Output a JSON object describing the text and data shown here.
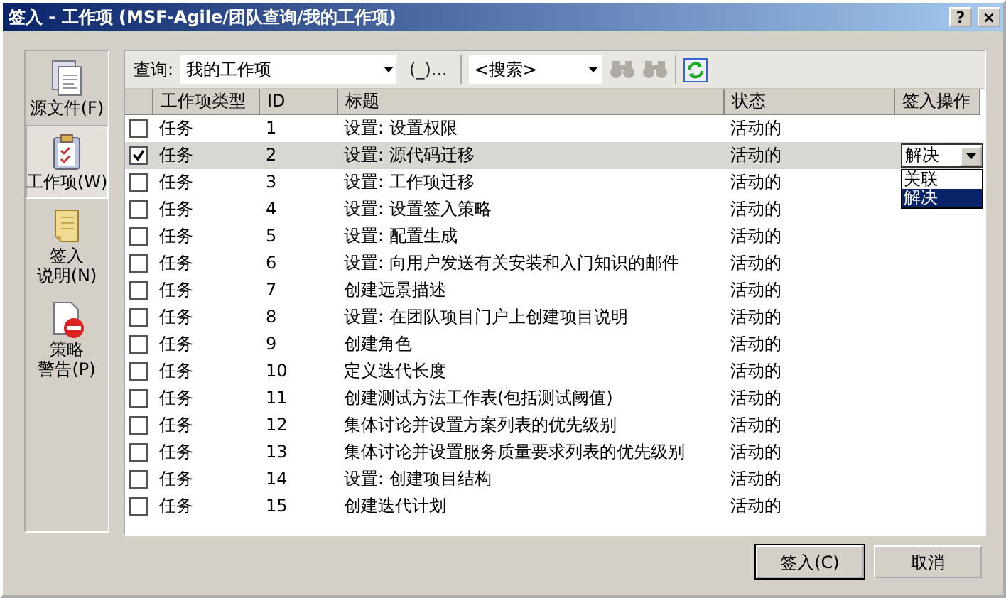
{
  "window": {
    "title": "签入 - 工作项 (MSF-Agile/团队查询/我的工作项)",
    "help_button": "?",
    "close_button": "×"
  },
  "sidebar": {
    "items": [
      {
        "label_lines": [
          "源文件(F)"
        ],
        "kind": "files",
        "selected": false
      },
      {
        "label_lines": [
          "工作项(W)"
        ],
        "kind": "clipboard",
        "selected": true
      },
      {
        "label_lines": [
          "签入",
          "说明(N)"
        ],
        "kind": "notes",
        "selected": false
      },
      {
        "label_lines": [
          "策略",
          "警告(P)"
        ],
        "kind": "policy",
        "selected": false
      }
    ]
  },
  "toolbar": {
    "query_label": "查询:",
    "query_value": "我的工作项",
    "browse_button": "(_)...",
    "search_value": "<搜索>"
  },
  "table": {
    "columns": [
      "工作项类型",
      "ID",
      "标题",
      "状态",
      "签入操作"
    ],
    "rows": [
      {
        "checked": false,
        "selected": false,
        "type": "任务",
        "id": "1",
        "title": "设置: 设置权限",
        "state": "活动的"
      },
      {
        "checked": true,
        "selected": true,
        "type": "任务",
        "id": "2",
        "title": "设置: 源代码迁移",
        "state": "活动的",
        "action": "解决",
        "action_options": [
          {
            "label": "关联",
            "selected": false
          },
          {
            "label": "解决",
            "selected": true
          }
        ]
      },
      {
        "checked": false,
        "selected": false,
        "type": "任务",
        "id": "3",
        "title": "设置: 工作项迁移",
        "state": "活动的"
      },
      {
        "checked": false,
        "selected": false,
        "type": "任务",
        "id": "4",
        "title": "设置: 设置签入策略",
        "state": "活动的"
      },
      {
        "checked": false,
        "selected": false,
        "type": "任务",
        "id": "5",
        "title": "设置: 配置生成",
        "state": "活动的"
      },
      {
        "checked": false,
        "selected": false,
        "type": "任务",
        "id": "6",
        "title": "设置: 向用户发送有关安装和入门知识的邮件",
        "state": "活动的"
      },
      {
        "checked": false,
        "selected": false,
        "type": "任务",
        "id": "7",
        "title": "创建远景描述",
        "state": "活动的"
      },
      {
        "checked": false,
        "selected": false,
        "type": "任务",
        "id": "8",
        "title": "设置: 在团队项目门户上创建项目说明",
        "state": "活动的"
      },
      {
        "checked": false,
        "selected": false,
        "type": "任务",
        "id": "9",
        "title": "创建角色",
        "state": "活动的"
      },
      {
        "checked": false,
        "selected": false,
        "type": "任务",
        "id": "10",
        "title": "定义迭代长度",
        "state": "活动的"
      },
      {
        "checked": false,
        "selected": false,
        "type": "任务",
        "id": "11",
        "title": "创建测试方法工作表(包括测试阈值)",
        "state": "活动的"
      },
      {
        "checked": false,
        "selected": false,
        "type": "任务",
        "id": "12",
        "title": "集体讨论并设置方案列表的优先级别",
        "state": "活动的"
      },
      {
        "checked": false,
        "selected": false,
        "type": "任务",
        "id": "13",
        "title": "集体讨论并设置服务质量要求列表的优先级别",
        "state": "活动的"
      },
      {
        "checked": false,
        "selected": false,
        "type": "任务",
        "id": "14",
        "title": "设置: 创建项目结构",
        "state": "活动的"
      },
      {
        "checked": false,
        "selected": false,
        "type": "任务",
        "id": "15",
        "title": "创建迭代计划",
        "state": "活动的"
      }
    ]
  },
  "buttons": [
    {
      "label": "签入(C)",
      "default": true
    },
    {
      "label": "取消",
      "default": false
    }
  ]
}
